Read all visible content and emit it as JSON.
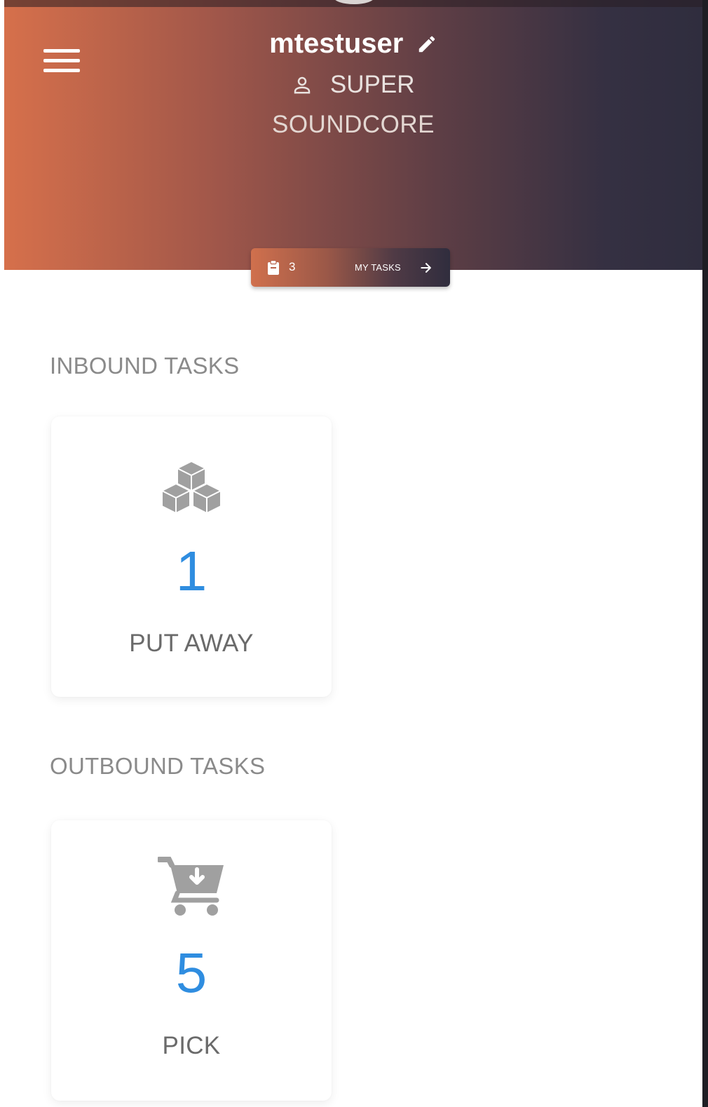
{
  "header": {
    "username": "mtestuser",
    "role": "SUPER",
    "company": "SOUNDCORE",
    "tasks_chip": {
      "count": "3",
      "label": "MY TASKS"
    }
  },
  "sections": {
    "inbound": {
      "heading": "INBOUND TASKS",
      "card": {
        "icon": "boxes-icon",
        "count": "1",
        "label": "PUT AWAY"
      }
    },
    "outbound": {
      "heading": "OUTBOUND TASKS",
      "card": {
        "icon": "cart-download-icon",
        "count": "5",
        "label": "PICK"
      }
    }
  },
  "colors": {
    "gradient_start": "#d6704b",
    "gradient_end": "#2f2d3e",
    "count_blue": "#2f8de0",
    "icon_gray": "#a0a0a0"
  }
}
